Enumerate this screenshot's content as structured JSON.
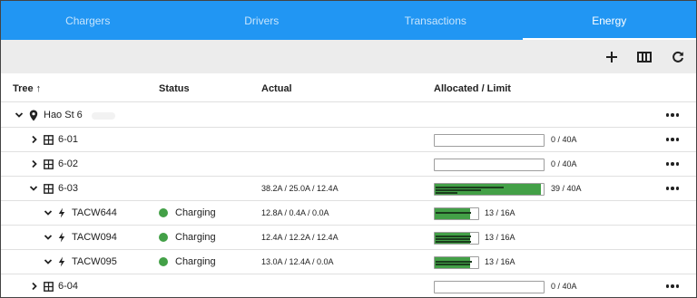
{
  "tabs": [
    {
      "label": "Chargers",
      "active": false
    },
    {
      "label": "Drivers",
      "active": false
    },
    {
      "label": "Transactions",
      "active": false
    },
    {
      "label": "Energy",
      "active": true
    }
  ],
  "toolbar": {
    "add_icon": "plus-icon",
    "columns_icon": "columns-icon",
    "refresh_icon": "refresh-icon"
  },
  "table": {
    "headers": {
      "tree": "Tree",
      "status": "Status",
      "actual": "Actual",
      "allocated": "Allocated / Limit"
    },
    "rows": [
      {
        "name": "Hao St 6",
        "status": "",
        "actual": "",
        "alloc": ""
      },
      {
        "name": "6-01",
        "status": "",
        "actual": "",
        "alloc": "0 / 40A",
        "fill": 0.0
      },
      {
        "name": "6-02",
        "status": "",
        "actual": "",
        "alloc": "0 / 40A",
        "fill": 0.0
      },
      {
        "name": "6-03",
        "status": "",
        "actual": "38.2A / 25.0A / 12.4A",
        "alloc": "39 / 40A",
        "fill": 0.975
      },
      {
        "name": "TACW644",
        "status": "Charging",
        "actual": "12.8A / 0.4A / 0.0A",
        "alloc": "13 / 16A",
        "fill": 0.8125
      },
      {
        "name": "TACW094",
        "status": "Charging",
        "actual": "12.4A / 12.2A / 12.4A",
        "alloc": "13 / 16A",
        "fill": 0.8125
      },
      {
        "name": "TACW095",
        "status": "Charging",
        "actual": "13.0A / 12.4A / 0.0A",
        "alloc": "13 / 16A",
        "fill": 0.8125
      },
      {
        "name": "6-04",
        "status": "",
        "actual": "",
        "alloc": "0 / 40A",
        "fill": 0.0
      }
    ]
  },
  "colors": {
    "accent": "#2196f3",
    "charging": "#43a047"
  }
}
